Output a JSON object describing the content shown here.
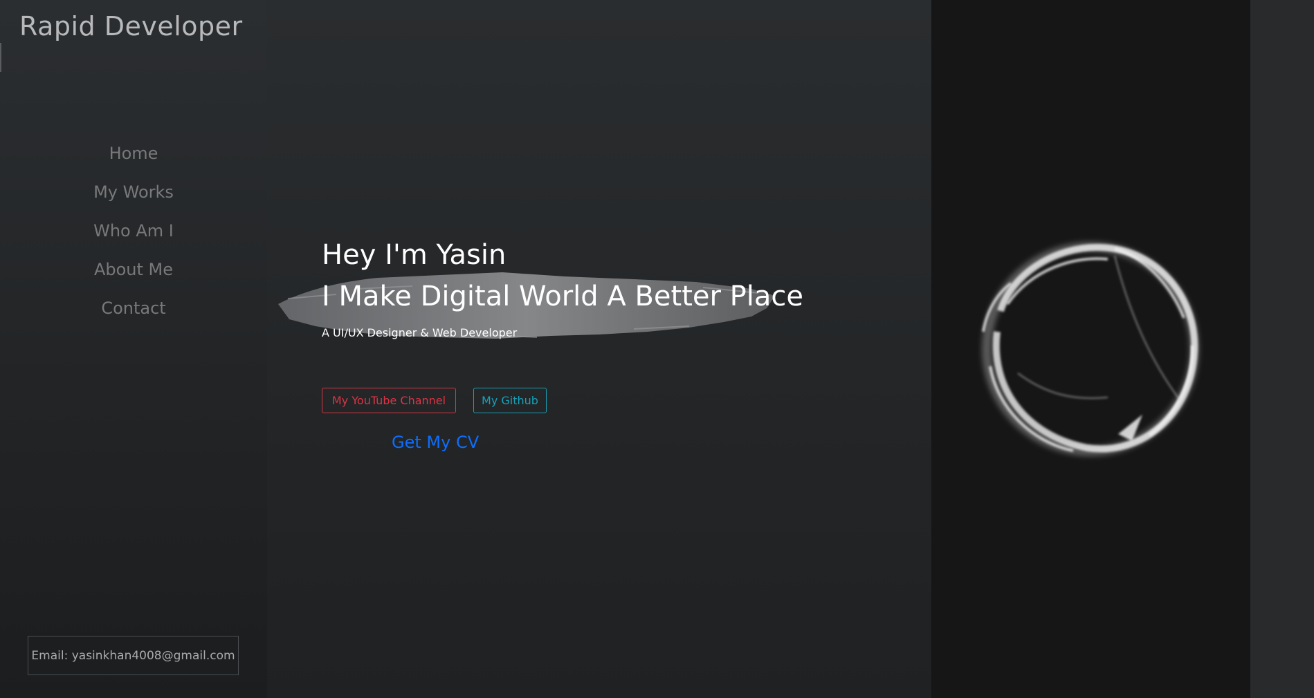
{
  "brand": {
    "title": "Rapid Developer"
  },
  "nav": {
    "items": [
      {
        "label": "Home"
      },
      {
        "label": "My Works"
      },
      {
        "label": "Who Am I"
      },
      {
        "label": "About Me"
      },
      {
        "label": "Contact"
      }
    ]
  },
  "contact": {
    "email_label": "Email: yasinkhan4008@gmail.com"
  },
  "hero": {
    "greeting": "Hey I'm Yasin",
    "tagline": "I Make Digital World A Better Place",
    "subtitle": "A UI/UX Designer & Web Developer",
    "youtube_button": "My YouTube Channel",
    "github_button": "My Github",
    "cv_link": "Get My CV"
  },
  "colors": {
    "youtube": "#dc3545",
    "github": "#17a2b8",
    "cv_link": "#0d6efd",
    "panel": "#161616"
  },
  "images": {
    "hero_graphic": "smoke-ring-image"
  }
}
